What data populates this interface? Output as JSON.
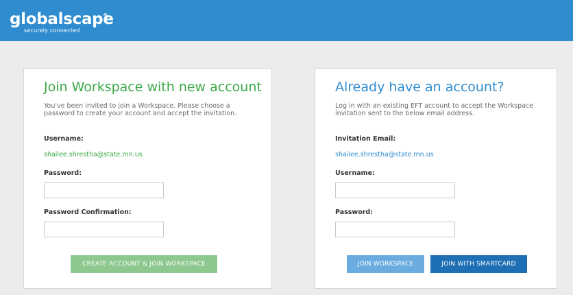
{
  "header": {
    "logo_name": "globalscape",
    "logo_tm": "®",
    "logo_tagline": "securely connected"
  },
  "new_account": {
    "title": "Join Workspace with new account",
    "description": "You've been invited to join a Workspace. Please choose a password to create your account and accept the invitation.",
    "username_label": "Username:",
    "username_value": "shailee.shrestha@state.mn.us",
    "password_label": "Password:",
    "password_value": "",
    "password_confirm_label": "Password Confirmation:",
    "password_confirm_value": "",
    "create_button": "CREATE ACCOUNT & JOIN WORKSPACE"
  },
  "existing_account": {
    "title": "Already have an account?",
    "description": "Log in with an existing EFT account to accept the Workspace invitation sent to the below email address.",
    "email_label": "Invitation Email:",
    "email_value": "shailee.shrestha@state.mn.us",
    "username_label": "Username:",
    "username_value": "",
    "password_label": "Password:",
    "password_value": "",
    "join_button": "JOIN WORKSPACE",
    "smartcard_button": "JOIN WITH SMARTCARD"
  },
  "colors": {
    "header": "#2f8ccf",
    "green": "#3aa845",
    "blue": "#2f8ccf",
    "create_button": "#8dc88f",
    "join_button": "#6aacdf",
    "smartcard_button": "#1f6fb5"
  }
}
